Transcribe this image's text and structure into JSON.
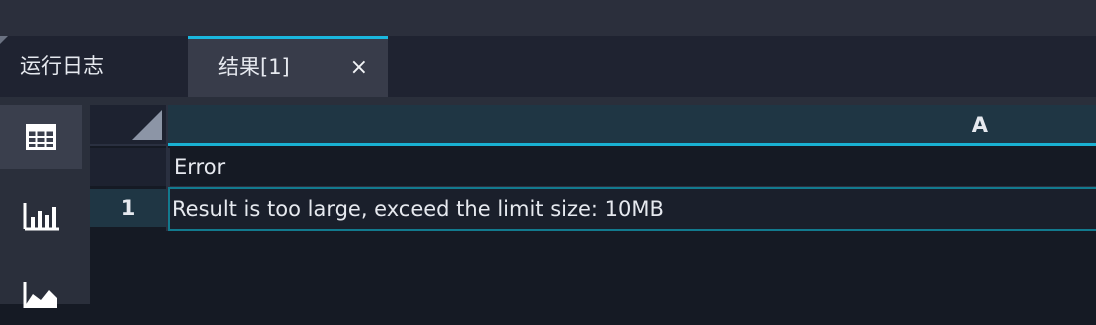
{
  "tabs": {
    "log_label": "运行日志",
    "result_label": "结果[1]",
    "close_glyph": "×"
  },
  "toolbar": {
    "buttons": [
      "table-icon",
      "bar-chart-icon",
      "area-chart-icon"
    ],
    "active": "table-icon"
  },
  "grid": {
    "column_headers": [
      "A"
    ],
    "header_row": {
      "row_label": "",
      "cells": [
        "Error"
      ]
    },
    "rows": [
      {
        "row_label": "1",
        "cells": [
          "Result is too large, exceed the limit size: 10MB"
        ]
      }
    ]
  },
  "colors": {
    "accent": "#1ab7de",
    "header_bg": "#1f3644",
    "panel_bg": "#151a24"
  }
}
